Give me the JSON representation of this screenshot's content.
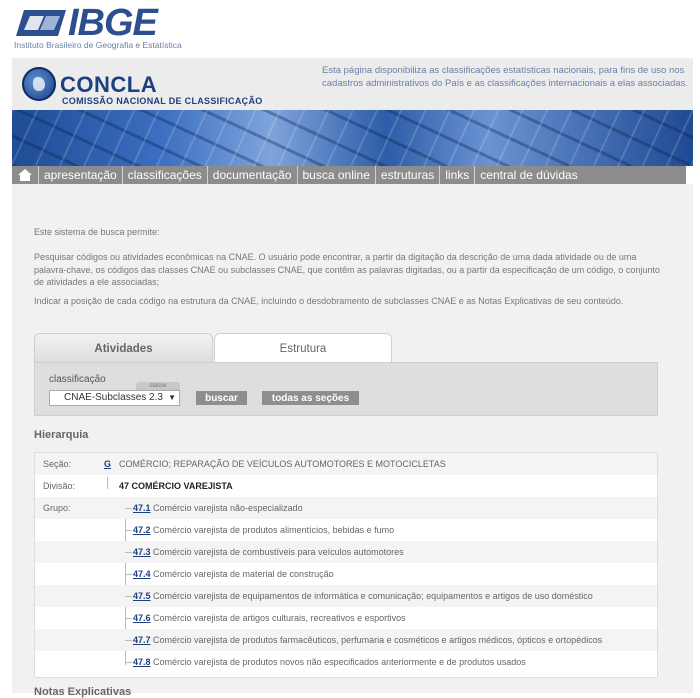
{
  "logo": {
    "brand": "IBGE",
    "tagline": "Instituto Brasileiro de Geografia e Estatística"
  },
  "header": {
    "title": "CONCLA",
    "subtitle": "COMISSÃO NACIONAL DE CLASSIFICAÇÃO",
    "description": "Esta página disponibiliza as classificações estatísticas nacionais, para fins de uso nos cadastros administrativos do País e as classificações internacionais a elas associadas."
  },
  "nav": {
    "home_icon": "home-icon",
    "items": [
      "apresentação",
      "classificações",
      "documentação",
      "busca online",
      "estruturas",
      "links",
      "central de dúvidas"
    ]
  },
  "intro": {
    "p1": "Este sistema de busca permite:",
    "p2": "Pesquisar códigos ou atividades econômicas na CNAE. O usuário pode encontrar, a partir da digitação da descrição de uma dada atividade ou de uma palavra-chave, os códigos das classes CNAE ou subclasses CNAE, que contêm as palavras digitadas, ou a partir da especificação de um código, o conjunto de atividades a ele associadas;",
    "p3": "Indicar a posição de cada código na estrutura da CNAE, incluindo o desdobramento de subclasses CNAE e as Notas Explicativas de seu conteúdo."
  },
  "tabs": {
    "atividades": "Atividades",
    "estrutura": "Estrutura"
  },
  "form": {
    "classificacao_label": "classificação",
    "key_tag": "classe",
    "selected": "CNAE-Subclasses 2.3",
    "buscar": "buscar",
    "todas": "todas as seções"
  },
  "hierarchy": {
    "title": "Hierarquia",
    "secao": {
      "label": "Seção:",
      "code": "G",
      "text": "COMÉRCIO; REPARAÇÃO DE VEÍCULOS AUTOMOTORES E MOTOCICLETAS"
    },
    "divisao": {
      "label": "Divisão:",
      "text": "47 COMÉRCIO VAREJISTA"
    },
    "grupo_label": "Grupo:",
    "grupos": [
      {
        "code": "47.1",
        "text": "Comércio varejista não-especializado"
      },
      {
        "code": "47.2",
        "text": "Comércio varejista de produtos alimentícios, bebidas e fumo"
      },
      {
        "code": "47.3",
        "text": "Comércio varejista de combustíveis para veículos automotores"
      },
      {
        "code": "47.4",
        "text": "Comércio varejista de material de construção"
      },
      {
        "code": "47.5",
        "text": "Comércio varejista de equipamentos de informática e comunicação; equipamentos e artigos de uso doméstico"
      },
      {
        "code": "47.6",
        "text": "Comércio varejista de artigos culturais, recreativos e esportivos"
      },
      {
        "code": "47.7",
        "text": "Comércio varejista de produtos farmacêuticos, perfumaria e cosméticos e artigos médicos, ópticos e ortopédicos"
      },
      {
        "code": "47.8",
        "text": "Comércio varejista de produtos novos não especificados anteriormente e de produtos usados"
      }
    ]
  },
  "footer_partial": "Notas Explicativas"
}
